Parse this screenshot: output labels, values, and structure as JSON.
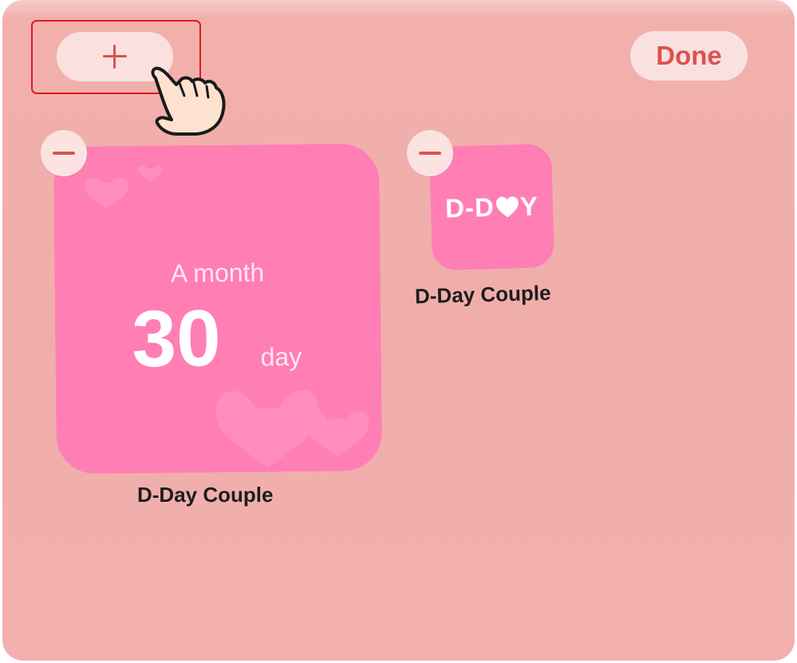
{
  "toolbar": {
    "add_icon": "plus-icon",
    "done_label": "Done"
  },
  "widgets": [
    {
      "app_name": "D-Day Couple",
      "size": "large",
      "caption": "A month",
      "count": "30",
      "unit": "day",
      "background": "#ff7eb4"
    },
    {
      "app_name": "D-Day Couple",
      "size": "small",
      "logo_text_left": "D-D",
      "logo_text_right": "Y",
      "background": "#ff7eb4"
    }
  ],
  "colors": {
    "screen_bg": "#f2b0ad",
    "accent": "#d9534f",
    "button_bg": "#fae1df",
    "highlight": "#e0191f"
  }
}
